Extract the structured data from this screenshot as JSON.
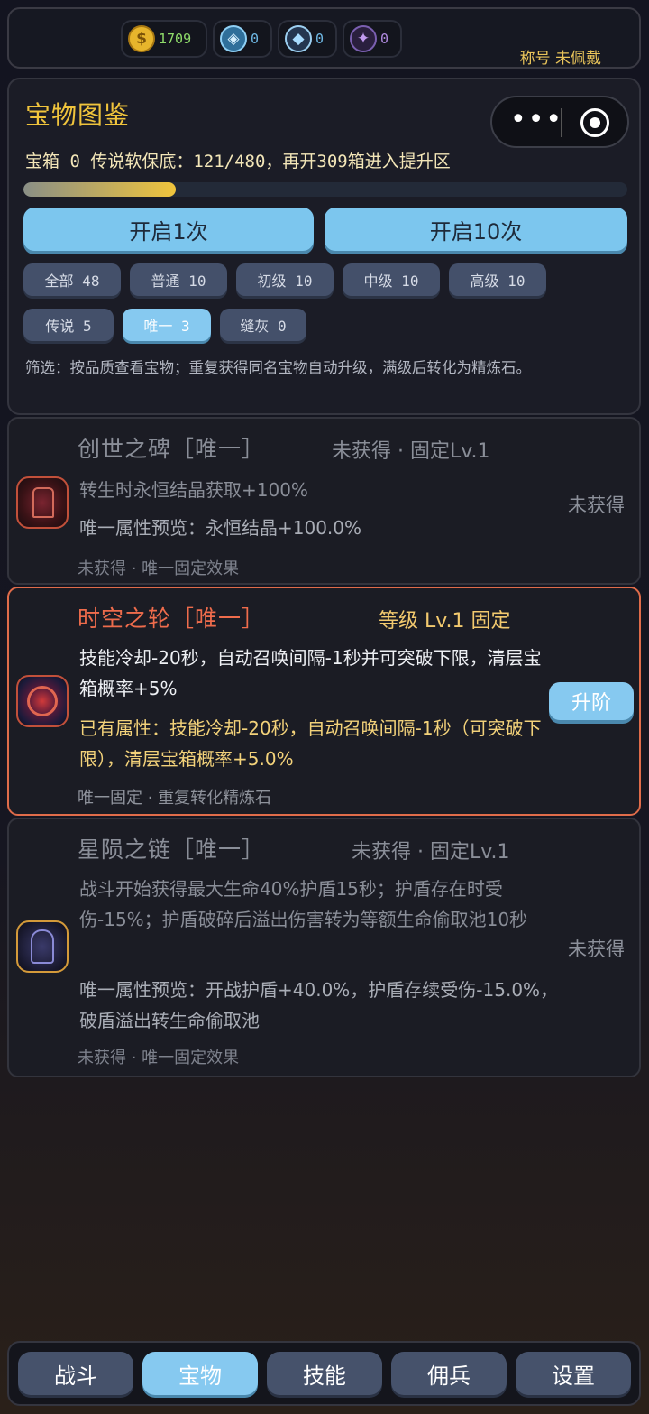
{
  "topbar": {
    "currencies": [
      {
        "icon": "gold-coin-icon",
        "glyph": "$",
        "value": "1709",
        "color": "#8fdc6a"
      },
      {
        "icon": "blue-crystal-icon",
        "glyph": "◈",
        "value": "0",
        "color": "#6fb9e6"
      },
      {
        "icon": "diamond-gem-icon",
        "glyph": "◆",
        "value": "0",
        "color": "#6fb9e6"
      },
      {
        "icon": "purple-crystal-icon",
        "glyph": "✦",
        "value": "0",
        "color": "#b08ae0"
      }
    ],
    "title_label": "称号  未佩戴"
  },
  "panel": {
    "title": "宝物图鉴",
    "status": "宝箱 0  传说软保底：121/480，再开309箱进入提升区",
    "progress": 0.252,
    "open_once": "开启1次",
    "open_ten": "开启10次",
    "filters": [
      {
        "label": "全部 48",
        "active": false
      },
      {
        "label": "普通 10",
        "active": false
      },
      {
        "label": "初级 10",
        "active": false
      },
      {
        "label": "中级 10",
        "active": false
      },
      {
        "label": "高级 10",
        "active": false
      },
      {
        "label": "传说 5",
        "active": false
      },
      {
        "label": "唯一 3",
        "active": true
      },
      {
        "label": "缝灰 0",
        "active": false
      }
    ],
    "hint": "筛选：按品质查看宝物；重复获得同名宝物自动升级，满级后转化为精炼石。"
  },
  "treasures": [
    {
      "name": "创世之碑［唯一］",
      "meta": "未获得  ·  固定Lv.1",
      "effect": "转生时永恒结晶获取+100%",
      "attr": "唯一属性预览：永恒结晶+100.0%",
      "footer": "未获得  ·  唯一固定效果",
      "right": "未获得",
      "icon": "stone-tablet-icon"
    },
    {
      "name": "时空之轮［唯一］",
      "meta": "等级 Lv.1 固定",
      "effect": "技能冷却-20秒，自动召唤间隔-1秒并可突破下限，清层宝箱概率+5%",
      "attr": "已有属性：技能冷却-20秒，自动召唤间隔-1秒（可突破下限），清层宝箱概率+5.0%",
      "footer": "唯一固定  ·  重复转化精炼石",
      "right": "升阶",
      "icon": "time-wheel-icon"
    },
    {
      "name": "星陨之链［唯一］",
      "meta": "未获得  ·  固定Lv.1",
      "effect": "战斗开始获得最大生命40%护盾15秒；护盾存在时受伤-15%；护盾破碎后溢出伤害转为等额生命偷取池10秒",
      "attr": "唯一属性预览：开战护盾+40.0%，护盾存续受伤-15.0%，破盾溢出转生命偷取池",
      "footer": "未获得  ·  唯一固定效果",
      "right": "未获得",
      "icon": "star-chain-icon"
    }
  ],
  "nav": [
    {
      "label": "战斗",
      "active": false
    },
    {
      "label": "宝物",
      "active": true
    },
    {
      "label": "技能",
      "active": false
    },
    {
      "label": "佣兵",
      "active": false
    },
    {
      "label": "设置",
      "active": false
    }
  ]
}
